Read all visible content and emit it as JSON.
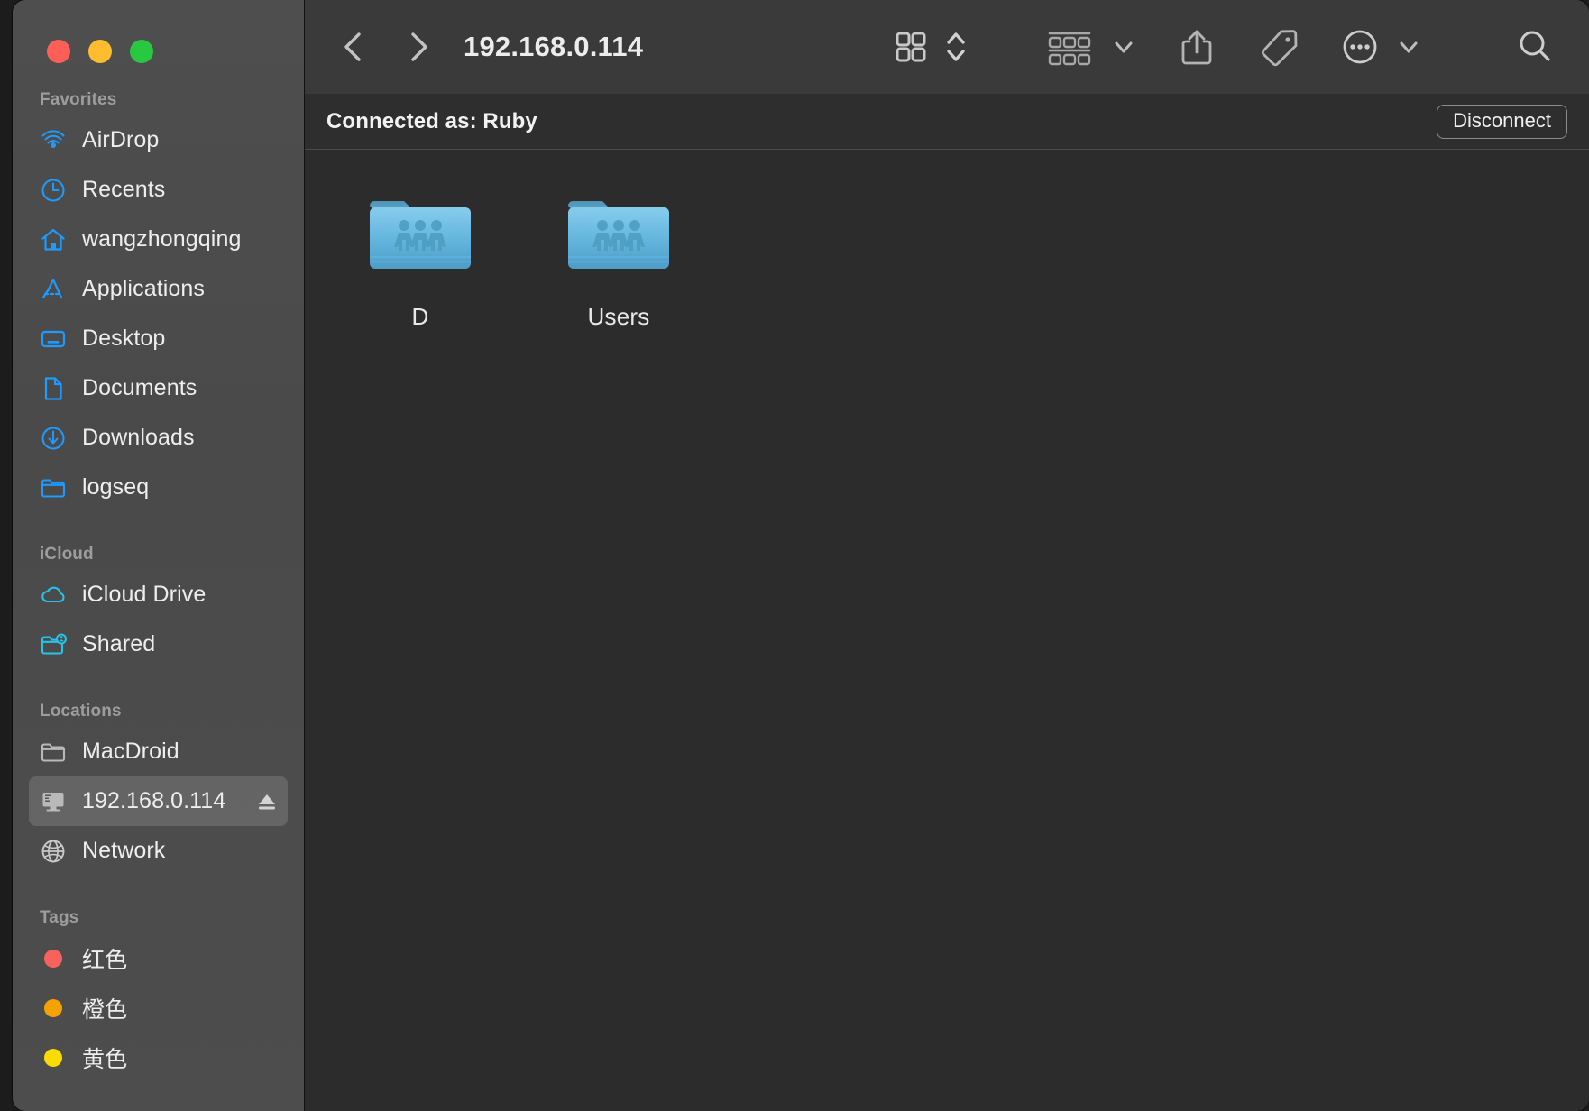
{
  "window": {
    "traffic_lights": [
      {
        "name": "close",
        "color": "#ff5f57"
      },
      {
        "name": "minimize",
        "color": "#febc2e"
      },
      {
        "name": "maximize",
        "color": "#28c840"
      }
    ]
  },
  "toolbar": {
    "back_label": "‹",
    "forward_label": "›",
    "title": "192.168.0.114",
    "view_icon": "grid-view-icon",
    "view_stepper_icon": "up-down-chevron-icon",
    "group_icon": "group-by-icon",
    "group_chevron_icon": "chevron-down-icon",
    "share_icon": "share-icon",
    "tag_icon": "tag-icon",
    "more_icon": "ellipsis-circle-icon",
    "more_chevron_icon": "chevron-down-icon",
    "search_icon": "search-icon"
  },
  "connection_bar": {
    "status": "Connected as: Ruby",
    "disconnect_label": "Disconnect"
  },
  "sidebar": {
    "sections": [
      {
        "title": "Favorites",
        "items": [
          {
            "label": "AirDrop",
            "icon": "airdrop-icon",
            "color": "#1e9bff"
          },
          {
            "label": "Recents",
            "icon": "clock-icon",
            "color": "#1e9bff"
          },
          {
            "label": "wangzhongqing",
            "icon": "home-icon",
            "color": "#1e9bff"
          },
          {
            "label": "Applications",
            "icon": "applications-icon",
            "color": "#1e9bff"
          },
          {
            "label": "Desktop",
            "icon": "desktop-icon",
            "color": "#1e9bff"
          },
          {
            "label": "Documents",
            "icon": "document-icon",
            "color": "#1e9bff"
          },
          {
            "label": "Downloads",
            "icon": "download-icon",
            "color": "#1e9bff"
          },
          {
            "label": "logseq",
            "icon": "folder-icon",
            "color": "#1e9bff"
          }
        ]
      },
      {
        "title": "iCloud",
        "items": [
          {
            "label": "iCloud Drive",
            "icon": "cloud-icon",
            "color": "#25c4e8"
          },
          {
            "label": "Shared",
            "icon": "shared-folder-icon",
            "color": "#25c4e8"
          }
        ]
      },
      {
        "title": "Locations",
        "items": [
          {
            "label": "MacDroid",
            "icon": "folder-icon",
            "color": "#b8b8b8",
            "selected": false
          },
          {
            "label": "192.168.0.114",
            "icon": "display-icon",
            "color": "#c9c9c9",
            "selected": true,
            "eject_icon": "eject-icon"
          },
          {
            "label": "Network",
            "icon": "globe-icon",
            "color": "#c9c9c9",
            "selected": false
          }
        ]
      },
      {
        "title": "Tags",
        "items": [
          {
            "label": "红色",
            "icon": "tag-dot-icon",
            "color": "#f9615c"
          },
          {
            "label": "橙色",
            "icon": "tag-dot-icon",
            "color": "#f5a201"
          },
          {
            "label": "黄色",
            "icon": "tag-dot-icon",
            "color": "#fcdb00"
          }
        ]
      }
    ]
  },
  "files": [
    {
      "label": "D",
      "icon": "shared-folder-icon"
    },
    {
      "label": "Users",
      "icon": "shared-folder-icon"
    }
  ]
}
